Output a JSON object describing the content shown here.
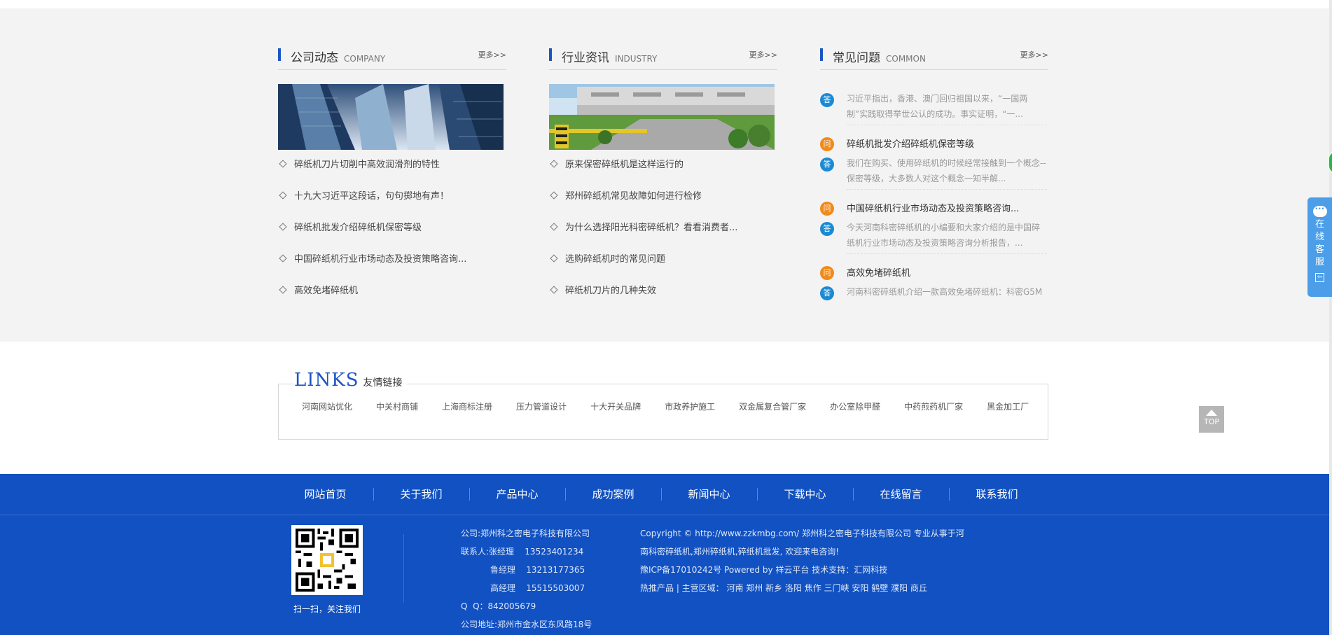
{
  "company_news": {
    "title": "公司动态",
    "subtitle": "COMPANY",
    "more": "更多>>",
    "items": [
      "碎纸机刀片切削中高效润滑剂的特性",
      "十九大习近平这段话，句句掷地有声！",
      "碎纸机批发介绍碎纸机保密等级",
      "中国碎纸机行业市场动态及投资策略咨询...",
      "高效免堵碎纸机"
    ]
  },
  "industry_news": {
    "title": "行业资讯",
    "subtitle": "INDUSTRY",
    "more": "更多>>",
    "items": [
      "原来保密碎纸机是这样运行的",
      "郑州碎纸机常见故障如何进行检修",
      "为什么选择阳光科密碎纸机？看看消费者...",
      "选购碎纸机时的常见问题",
      "碎纸机刀片的几种失效"
    ]
  },
  "faq": {
    "title": "常见问题",
    "subtitle": "COMMON",
    "more": "更多>>",
    "q_badge": "问",
    "a_badge": "答",
    "first_answer": "习近平指出，香港、澳门回归祖国以来，“一国两制”实践取得举世公认的成功。事实证明，“一...",
    "items": [
      {
        "q": "碎纸机批发介绍碎纸机保密等级",
        "a": "我们在购买、使用碎纸机的时候经常接触到一个概念--保密等级，大多数人对这个概念一知半解..."
      },
      {
        "q": "中国碎纸机行业市场动态及投资策略咨询...",
        "a": "今天河南科密碎纸机的小编要和大家介绍的是中国碎纸机行业市场动态及投资策略咨询分析报告，..."
      },
      {
        "q": "高效免堵碎纸机",
        "a": "河南科密碎纸机介绍一款高效免堵碎纸机：科密G5M"
      }
    ]
  },
  "links": {
    "title_en": "LINKS",
    "title_cn": "友情链接",
    "items": [
      "河南网站优化",
      "中关村商铺",
      "上海商标注册",
      "压力管道设计",
      "十大开关品牌",
      "市政养护施工",
      "双金属复合管厂家",
      "办公室除甲醛",
      "中药煎药机厂家",
      "黑金加工厂"
    ]
  },
  "top_button": "TOP",
  "service": {
    "chars": [
      "在",
      "线",
      "客",
      "服"
    ]
  },
  "footer": {
    "nav": [
      "网站首页",
      "关于我们",
      "产品中心",
      "成功案例",
      "新闻中心",
      "下载中心",
      "在线留言",
      "联系我们"
    ],
    "qr_caption": "扫一扫，关注我们",
    "contact": [
      "公司:郑州科之密电子科技有限公司",
      "联系人:张经理    13523401234",
      "           鲁经理    13213177365",
      "           高经理    15515503007",
      "Q  Q：842005679",
      "公司地址:郑州市金水区东风路18号"
    ],
    "copyright": [
      "Copyright © http://www.zzkmbg.com/ 郑州科之密电子科技有限公司 专业从事于河",
      "南科密碎纸机,郑州碎纸机,碎纸机批发, 欢迎来电咨询!",
      "豫ICP备17010242号  Powered by 祥云平台  技术支持：汇网科技",
      "热推产品  |  主营区域： 河南  郑州  新乡  洛阳  焦作  三门峡  安阳  鹤壁  濮阳  商丘"
    ]
  },
  "colors": {
    "brand_blue": "#1151c1",
    "accent_blue": "#1a55c4",
    "question_badge": "#f08a1a",
    "answer_badge": "#1a8ad4"
  }
}
